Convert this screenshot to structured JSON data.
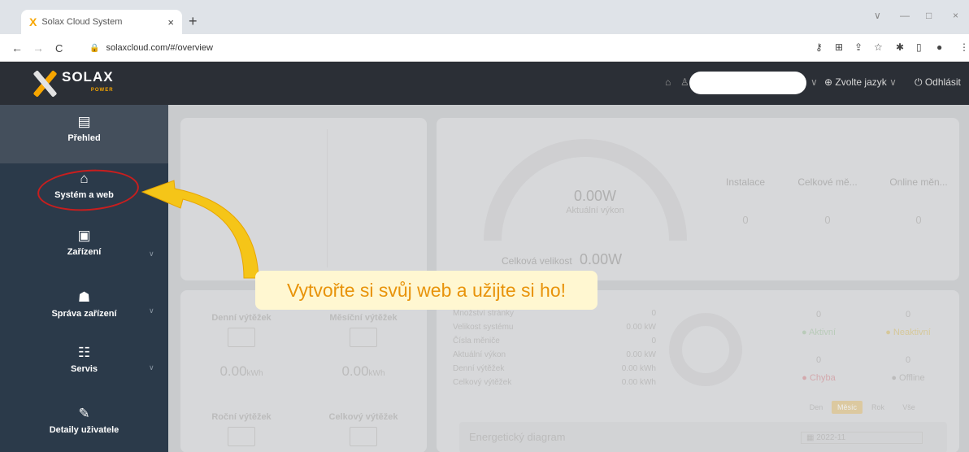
{
  "browser": {
    "tab_title": "Solax Cloud System",
    "tab_close": "×",
    "new_tab": "+",
    "url": "solaxcloud.com/#/overview",
    "back": "←",
    "forward": "→",
    "reload": "C",
    "window_controls": [
      "∨",
      "—",
      "□",
      "×"
    ],
    "toolbar_icons": [
      "key-icon",
      "translate-icon",
      "share-icon",
      "star-icon",
      "extensions-icon",
      "sidepanel-icon",
      "profile-icon",
      "menu-icon"
    ]
  },
  "header": {
    "logo_text": "SOLAX",
    "logo_sub": "POWER",
    "lang_label": "Zvolte jazyk",
    "logout_label": "Odhlásit"
  },
  "sidebar": {
    "items": [
      {
        "label": "Přehled",
        "icon": "document-icon",
        "active": true
      },
      {
        "label": "Systém a web",
        "icon": "home-icon",
        "active": false
      },
      {
        "label": "Zařízení",
        "icon": "device-icon",
        "active": false
      },
      {
        "label": "Správa zařízení",
        "icon": "user-device-icon",
        "active": false
      },
      {
        "label": "Servis",
        "icon": "service-icon",
        "active": false
      },
      {
        "label": "Detaily uživatele",
        "icon": "edit-icon",
        "active": false
      }
    ]
  },
  "overview": {
    "power_value": "0.00W",
    "power_label": "Aktuální výkon",
    "total_size_label": "Celková velikost",
    "total_size_value": "0.00W",
    "stats": [
      {
        "label": "Instalace",
        "value": "0"
      },
      {
        "label": "Celkové mě...",
        "value": "0"
      },
      {
        "label": "Online měn...",
        "value": "0"
      }
    ],
    "yield_cards": [
      {
        "label": "Denní výtěžek",
        "value": "0.00",
        "unit": "kWh"
      },
      {
        "label": "Měsíční výtěžek",
        "value": "0.00",
        "unit": "kWh"
      },
      {
        "label": "Roční výtěžek"
      },
      {
        "label": "Celkový výtěžek"
      }
    ],
    "summary": [
      {
        "label": "Množství stránky",
        "value": "0"
      },
      {
        "label": "Velikost systému",
        "value": "0.00 kW"
      },
      {
        "label": "Čísla měniče",
        "value": "0"
      },
      {
        "label": "Aktuální výkon",
        "value": "0.00 kW"
      },
      {
        "label": "Denní výtěžek",
        "value": "0.00 kWh"
      },
      {
        "label": "Celkový výtěžek",
        "value": "0.00 kWh"
      }
    ],
    "status": [
      {
        "value": "0",
        "label": "Aktivní"
      },
      {
        "value": "0",
        "label": "Neaktivní"
      },
      {
        "value": "0",
        "label": "Chyba"
      },
      {
        "value": "0",
        "label": "Offline"
      }
    ],
    "period_tabs": [
      "Den",
      "Měsíc",
      "Rok",
      "Vše"
    ],
    "energy_title": "Energetický diagram",
    "energy_date": "2022-11"
  },
  "callout": {
    "text": "Vytvořte si svůj web a užijte si ho!"
  },
  "colors": {
    "accent": "#f7a600",
    "sidebar": "#2b3a4a",
    "header": "#2b2f36",
    "highlight_ring": "#c81e1e"
  }
}
